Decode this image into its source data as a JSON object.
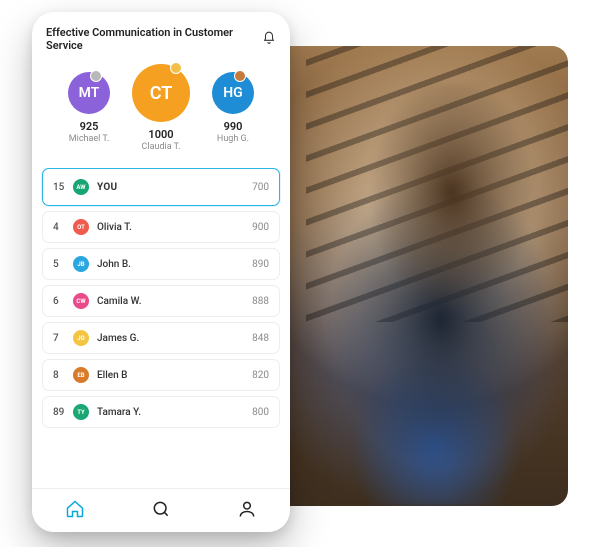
{
  "header": {
    "title": "Effective Communication in Customer Service"
  },
  "podium": {
    "left": {
      "initials": "MT",
      "score": "925",
      "name": "Michael T."
    },
    "center": {
      "initials": "CT",
      "score": "1000",
      "name": "Claudia T."
    },
    "right": {
      "initials": "HG",
      "score": "990",
      "name": "Hugh G."
    }
  },
  "you_row": {
    "rank": "15",
    "avatarText": "AW",
    "avatarColor": "#17a673",
    "name": "YOU",
    "score": "700"
  },
  "rows": [
    {
      "rank": "4",
      "avatarText": "OT",
      "avatarColor": "#ef5b4c",
      "name": "Olivia T.",
      "score": "900"
    },
    {
      "rank": "5",
      "avatarText": "JB",
      "avatarColor": "#2aa7e1",
      "name": "John B.",
      "score": "890"
    },
    {
      "rank": "6",
      "avatarText": "CW",
      "avatarColor": "#e94b8a",
      "name": "Camila W.",
      "score": "888"
    },
    {
      "rank": "7",
      "avatarText": "JG",
      "avatarColor": "#f4c542",
      "name": "James G.",
      "score": "848"
    },
    {
      "rank": "8",
      "avatarText": "EB",
      "avatarColor": "#d87a2a",
      "name": "Ellen B",
      "score": "820"
    },
    {
      "rank": "89",
      "avatarText": "TY",
      "avatarColor": "#1aa774",
      "name": "Tamara Y.",
      "score": "800"
    }
  ]
}
